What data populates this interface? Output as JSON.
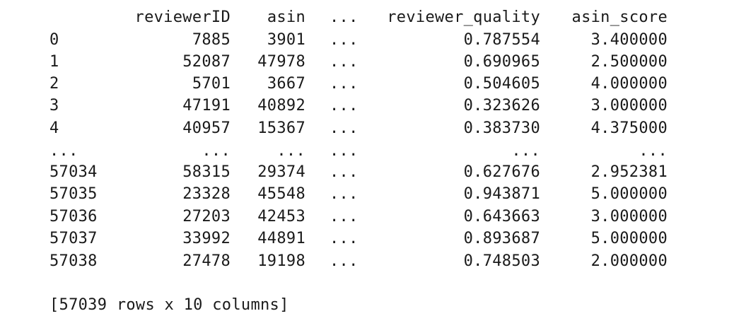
{
  "table": {
    "columns": {
      "reviewerID": "reviewerID",
      "asin": "asin",
      "ellipsis": "...",
      "reviewer_quality": "reviewer_quality",
      "asin_score": "asin_score"
    },
    "rows": [
      {
        "index": "0",
        "reviewerID": "7885",
        "asin": "3901",
        "ellipsis": "...",
        "reviewer_quality": "0.787554",
        "asin_score": "3.400000"
      },
      {
        "index": "1",
        "reviewerID": "52087",
        "asin": "47978",
        "ellipsis": "...",
        "reviewer_quality": "0.690965",
        "asin_score": "2.500000"
      },
      {
        "index": "2",
        "reviewerID": "5701",
        "asin": "3667",
        "ellipsis": "...",
        "reviewer_quality": "0.504605",
        "asin_score": "4.000000"
      },
      {
        "index": "3",
        "reviewerID": "47191",
        "asin": "40892",
        "ellipsis": "...",
        "reviewer_quality": "0.323626",
        "asin_score": "3.000000"
      },
      {
        "index": "4",
        "reviewerID": "40957",
        "asin": "15367",
        "ellipsis": "...",
        "reviewer_quality": "0.383730",
        "asin_score": "4.375000"
      },
      {
        "index": "...",
        "reviewerID": "...",
        "asin": "...",
        "ellipsis": "...",
        "reviewer_quality": "...",
        "asin_score": "..."
      },
      {
        "index": "57034",
        "reviewerID": "58315",
        "asin": "29374",
        "ellipsis": "...",
        "reviewer_quality": "0.627676",
        "asin_score": "2.952381"
      },
      {
        "index": "57035",
        "reviewerID": "23328",
        "asin": "45548",
        "ellipsis": "...",
        "reviewer_quality": "0.943871",
        "asin_score": "5.000000"
      },
      {
        "index": "57036",
        "reviewerID": "27203",
        "asin": "42453",
        "ellipsis": "...",
        "reviewer_quality": "0.643663",
        "asin_score": "3.000000"
      },
      {
        "index": "57037",
        "reviewerID": "33992",
        "asin": "44891",
        "ellipsis": "...",
        "reviewer_quality": "0.893687",
        "asin_score": "5.000000"
      },
      {
        "index": "57038",
        "reviewerID": "27478",
        "asin": "19198",
        "ellipsis": "...",
        "reviewer_quality": "0.748503",
        "asin_score": "2.000000"
      }
    ],
    "summary": "[57039 rows x 10 columns]"
  }
}
